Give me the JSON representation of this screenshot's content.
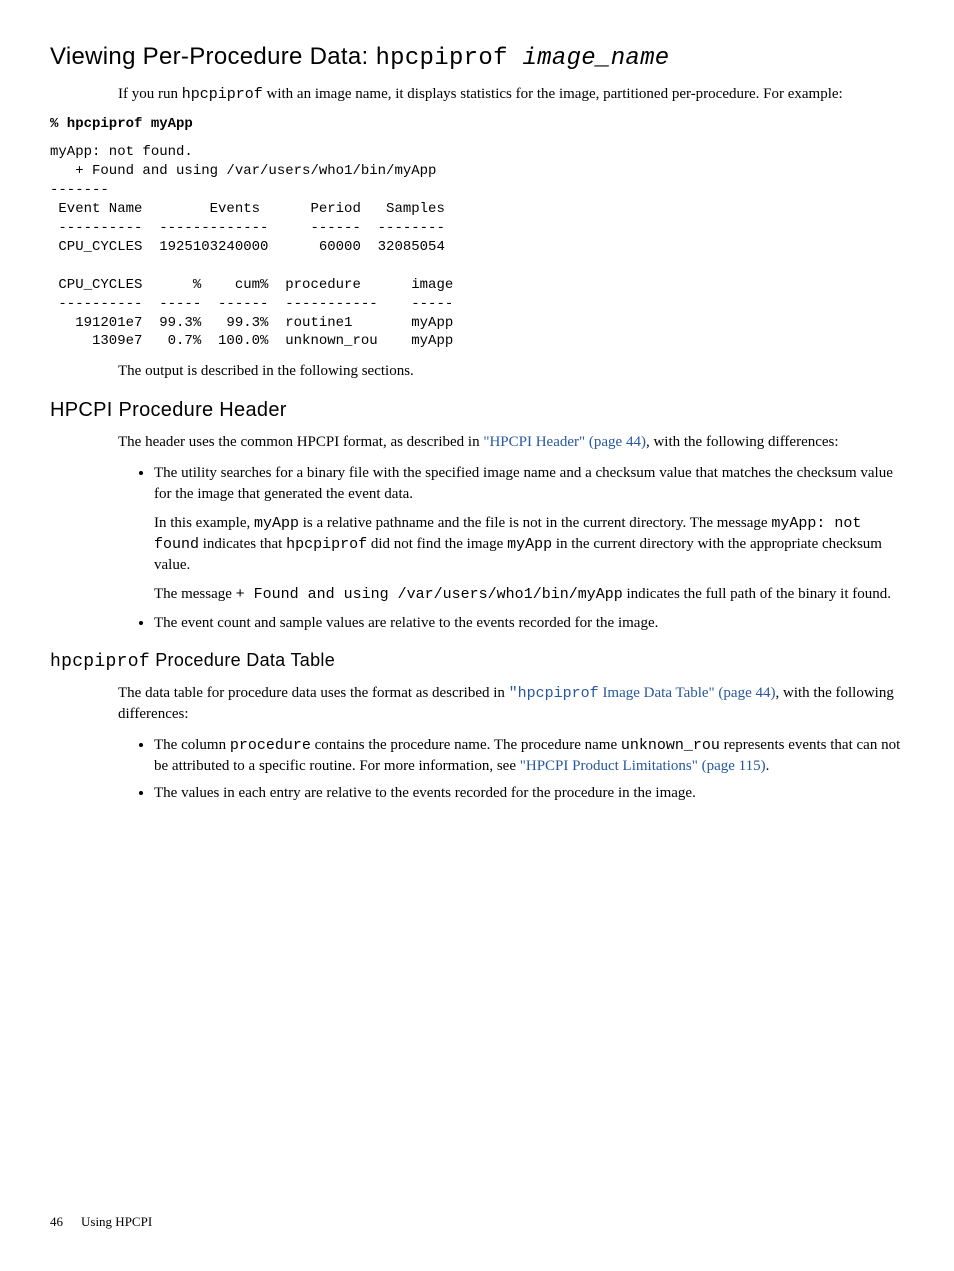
{
  "h2_prefix": "Viewing Per-Procedure Data: ",
  "h2_mono": "hpcpiprof",
  "h2_italic": " image_name",
  "intro_p_a": "If you run ",
  "intro_mono": "hpcpiprof",
  "intro_p_b": " with an image name, it displays statistics for the image, partitioned per-procedure. For example:",
  "cmd_prompt": "% hpcpiprof myApp",
  "pre_block": "myApp: not found.\n   + Found and using /var/users/who1/bin/myApp\n-------\n Event Name        Events      Period   Samples\n ----------  -------------     ------  --------\n CPU_CYCLES  1925103240000      60000  32085054\n\n CPU_CYCLES      %    cum%  procedure      image\n ----------  -----  ------  -----------    -----\n   191201e7  99.3%   99.3%  routine1       myApp\n     1309e7   0.7%  100.0%  unknown_rou    myApp",
  "output_described": "The output is described in the following sections.",
  "h3_procedure_header": "HPCPI Procedure Header",
  "header_p_a": "The header uses the common HPCPI format, as described in ",
  "header_link": "\"HPCPI Header\" (page 44)",
  "header_p_b": ", with the following differences:",
  "bullets1": {
    "b1_p1": "The utility searches for a binary file with the specified image name and a checksum value that matches the checksum value for the image that generated the event data.",
    "b1_p2_a": "In this example, ",
    "b1_p2_mono1": "myApp",
    "b1_p2_b": " is a relative pathname and the file is not in the current directory. The message ",
    "b1_p2_mono2": "myApp: not found",
    "b1_p2_c": " indicates that ",
    "b1_p2_mono3": "hpcpiprof",
    "b1_p2_d": " did not find the image ",
    "b1_p2_mono4": "myApp",
    "b1_p2_e": " in the current directory with the appropriate checksum value.",
    "b1_p3_a": "The message ",
    "b1_p3_mono": "+ Found and using /var/users/who1/bin/myApp",
    "b1_p3_b": " indicates the full path of the binary it found.",
    "b2": "The event count and sample values are relative to the events recorded for the image."
  },
  "h4_mono": "hpcpiprof",
  "h4_rest": " Procedure Data Table",
  "table_p_a": "The data table for procedure data uses the format as described in ",
  "table_link_mono": "\"hpcpiprof",
  "table_link_rest": " Image Data Table\" (page 44)",
  "table_p_b": ", with the following differences:",
  "bullets2": {
    "b1_a": "The column ",
    "b1_mono1": "procedure",
    "b1_b": " contains the procedure name. The procedure name ",
    "b1_mono2": "unknown_rou",
    "b1_c": " represents events that can not be attributed to a specific routine. For more information, see ",
    "b1_link": "\"HPCPI Product Limitations\" (page 115)",
    "b1_d": ".",
    "b2": "The values in each entry are relative to the events recorded for the procedure in the image."
  },
  "footer_page": "46",
  "footer_title": "Using HPCPI"
}
